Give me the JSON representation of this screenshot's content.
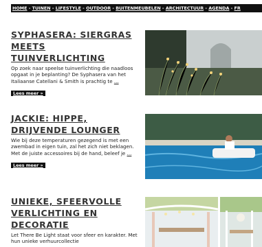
{
  "nav": {
    "items": [
      "HOME",
      "TUINEN",
      "LIFESTYLE",
      "OUTDOOR",
      "BUITENMEUBELEN",
      "ARCHITECTUUR",
      "AGENDA",
      "FR"
    ],
    "separator": " - "
  },
  "articles": [
    {
      "title": "SYPHASERA: SIERGRAS MEETS TUINVERLICHTING",
      "excerpt": "Op zoek naar speelse tuinverlichting die naadloos opgaat in je beplanting? De Syphasera van het Italiaanse Catellani & Smith is prachtig te ",
      "ellipsis": "...",
      "more_label": "Lees meer »"
    },
    {
      "title": "JACKIE: HIPPE, DRIJVENDE LOUNGER",
      "excerpt": "Wie bij deze temperaturen gezegend is met een zwembad in eigen tuin, zal het zich niet beklagen. Met de juiste accessoires bij de hand, beleef je ",
      "ellipsis": "...",
      "more_label": "Lees meer »"
    },
    {
      "title": "UNIEKE, SFEERVOLLE VERLICHTING EN DECORATIE",
      "excerpt": "Let There Be Light staat voor sfeer en karakter. Met hun unieke verhuurcollectie",
      "ellipsis": "",
      "more_label": ""
    }
  ],
  "colors": {
    "nav_bg": "#111111",
    "title": "#333333",
    "pool": "#1f7fb8"
  }
}
